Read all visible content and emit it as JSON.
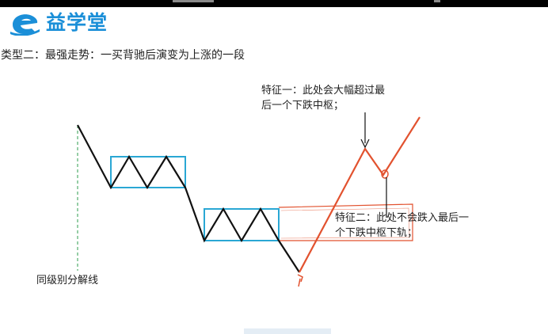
{
  "header": {
    "brand_name": "益学堂",
    "logo_icon": "e-logo-icon",
    "brand_color": "#1b8fd8"
  },
  "slide": {
    "subtitle": "类型二：最强走势：一买背驰后演变为上涨的一段"
  },
  "annotations": {
    "feature1_line1": "特征一：此处会大幅超过最",
    "feature1_line2": "后一个下跌中枢；",
    "feature2_line1": "特征二：此处不会跌入最后一",
    "feature2_line2": "个下跌中枢下轨；",
    "level_line_label": "同级别分解线",
    "handwritten_mark": "√"
  },
  "colors": {
    "price_line": "#111111",
    "pivot_box": "#2aa7d4",
    "rise_line": "#e2522f",
    "level_line": "#2e9e4c"
  }
}
